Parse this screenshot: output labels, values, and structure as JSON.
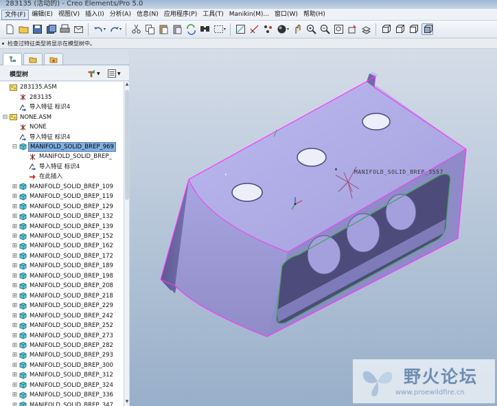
{
  "window": {
    "title": "283135 (活动的) - Creo Elements/Pro 5.0"
  },
  "menu": [
    {
      "label": "文件(F)",
      "name": "menu-file",
      "active": true
    },
    {
      "label": "编辑(E)",
      "name": "menu-edit"
    },
    {
      "label": "视图(V)",
      "name": "menu-view"
    },
    {
      "label": "插入(I)",
      "name": "menu-insert"
    },
    {
      "label": "分析(A)",
      "name": "menu-analysis"
    },
    {
      "label": "信息(N)",
      "name": "menu-info"
    },
    {
      "label": "应用程序(P)",
      "name": "menu-applications"
    },
    {
      "label": "工具(T)",
      "name": "menu-tools"
    },
    {
      "label": "Manikin(M)...",
      "name": "menu-manikin"
    },
    {
      "label": "窗口(W)",
      "name": "menu-window"
    },
    {
      "label": "帮助(H)",
      "name": "menu-help"
    }
  ],
  "toolbar": {
    "icons": [
      "new-file-icon",
      "open-folder-icon",
      "save-icon",
      "save-copy-icon",
      "print-icon",
      "email-icon",
      "|",
      "undo-icon",
      "redo-icon",
      "|",
      "cut-icon",
      "copy-icon",
      "paste-icon",
      "paste-special-icon",
      "regenerate-icon",
      "find-icon",
      "select-box-icon",
      "|",
      "datum-display-icon",
      "axis-display-icon",
      "point-display-icon",
      "shading-icon",
      "spin-center-icon",
      "zoom-in-icon",
      "zoom-out-icon",
      "refit-icon",
      "view-manager-icon",
      "saved-views-icon",
      "|",
      "wireframe-icon",
      "hidden-line-icon",
      "no-hidden-icon",
      "shaded-icon"
    ]
  },
  "status": {
    "message": "检查过特征类型将显示在模型树中。"
  },
  "navigator": {
    "tabs": [
      "model-tree-tab-icon",
      "folder-browser-tab-icon",
      "favorites-tab-icon"
    ],
    "header_label": "模型树"
  },
  "tree": [
    {
      "indent": 0,
      "expander": "",
      "icon": "asm",
      "label": "283135.ASM"
    },
    {
      "indent": 1,
      "expander": "",
      "icon": "csys",
      "label": "283135"
    },
    {
      "indent": 1,
      "expander": "",
      "icon": "import",
      "label": "导入特征 标识4"
    },
    {
      "indent": 0,
      "expander": "minus",
      "icon": "asm",
      "label": "NONE.ASM"
    },
    {
      "indent": 1,
      "expander": "",
      "icon": "csys",
      "label": "NONE"
    },
    {
      "indent": 1,
      "expander": "",
      "icon": "import",
      "label": "导入特征 标识4"
    },
    {
      "indent": 1,
      "expander": "minus",
      "icon": "part",
      "label": "MANIFOLD_SOLID_BREP_969",
      "selected": true
    },
    {
      "indent": 2,
      "expander": "",
      "icon": "csys",
      "label": "MANIFOLD_SOLID_BREP_"
    },
    {
      "indent": 2,
      "expander": "",
      "icon": "import",
      "label": "导入特征 标识4"
    },
    {
      "indent": 2,
      "expander": "",
      "icon": "insert",
      "label": "在此插入"
    },
    {
      "indent": 1,
      "expander": "plus",
      "icon": "part",
      "label": "MANIFOLD_SOLID_BREP_109"
    },
    {
      "indent": 1,
      "expander": "plus",
      "icon": "part",
      "label": "MANIFOLD_SOLID_BREP_119"
    },
    {
      "indent": 1,
      "expander": "plus",
      "icon": "part",
      "label": "MANIFOLD_SOLID_BREP_129"
    },
    {
      "indent": 1,
      "expander": "plus",
      "icon": "part",
      "label": "MANIFOLD_SOLID_BREP_132"
    },
    {
      "indent": 1,
      "expander": "plus",
      "icon": "part",
      "label": "MANIFOLD_SOLID_BREP_139"
    },
    {
      "indent": 1,
      "expander": "plus",
      "icon": "part",
      "label": "MANIFOLD_SOLID_BREP_152"
    },
    {
      "indent": 1,
      "expander": "plus",
      "icon": "part",
      "label": "MANIFOLD_SOLID_BREP_162"
    },
    {
      "indent": 1,
      "expander": "plus",
      "icon": "part",
      "label": "MANIFOLD_SOLID_BREP_172"
    },
    {
      "indent": 1,
      "expander": "plus",
      "icon": "part",
      "label": "MANIFOLD_SOLID_BREP_189"
    },
    {
      "indent": 1,
      "expander": "plus",
      "icon": "part",
      "label": "MANIFOLD_SOLID_BREP_198"
    },
    {
      "indent": 1,
      "expander": "plus",
      "icon": "part",
      "label": "MANIFOLD_SOLID_BREP_208"
    },
    {
      "indent": 1,
      "expander": "plus",
      "icon": "part",
      "label": "MANIFOLD_SOLID_BREP_218"
    },
    {
      "indent": 1,
      "expander": "plus",
      "icon": "part",
      "label": "MANIFOLD_SOLID_BREP_229"
    },
    {
      "indent": 1,
      "expander": "plus",
      "icon": "part",
      "label": "MANIFOLD_SOLID_BREP_242"
    },
    {
      "indent": 1,
      "expander": "plus",
      "icon": "part",
      "label": "MANIFOLD_SOLID_BREP_252"
    },
    {
      "indent": 1,
      "expander": "plus",
      "icon": "part",
      "label": "MANIFOLD_SOLID_BREP_273"
    },
    {
      "indent": 1,
      "expander": "plus",
      "icon": "part",
      "label": "MANIFOLD_SOLID_BREP_282"
    },
    {
      "indent": 1,
      "expander": "plus",
      "icon": "part",
      "label": "MANIFOLD_SOLID_BREP_293"
    },
    {
      "indent": 1,
      "expander": "plus",
      "icon": "part",
      "label": "MANIFOLD_SOLID_BREP_300"
    },
    {
      "indent": 1,
      "expander": "plus",
      "icon": "part",
      "label": "MANIFOLD_SOLID_BREP_312"
    },
    {
      "indent": 1,
      "expander": "plus",
      "icon": "part",
      "label": "MANIFOLD_SOLID_BREP_324"
    },
    {
      "indent": 1,
      "expander": "plus",
      "icon": "part",
      "label": "MANIFOLD_SOLID_BREP_336"
    },
    {
      "indent": 1,
      "expander": "plus",
      "icon": "part",
      "label": "MANIFOLD_SOLID_BREP_347"
    }
  ],
  "viewport": {
    "csys_label": "MANIFOLD_SOLID_BREP_3557",
    "model_face_color": "#a9a6e3",
    "model_shadow_color": "#6f6ca8",
    "highlight_color": "#ff33ff",
    "edge_green_color": "#3aa84a"
  },
  "watermark": {
    "title": "野火论坛",
    "url": "www.proewildfire.cn"
  }
}
